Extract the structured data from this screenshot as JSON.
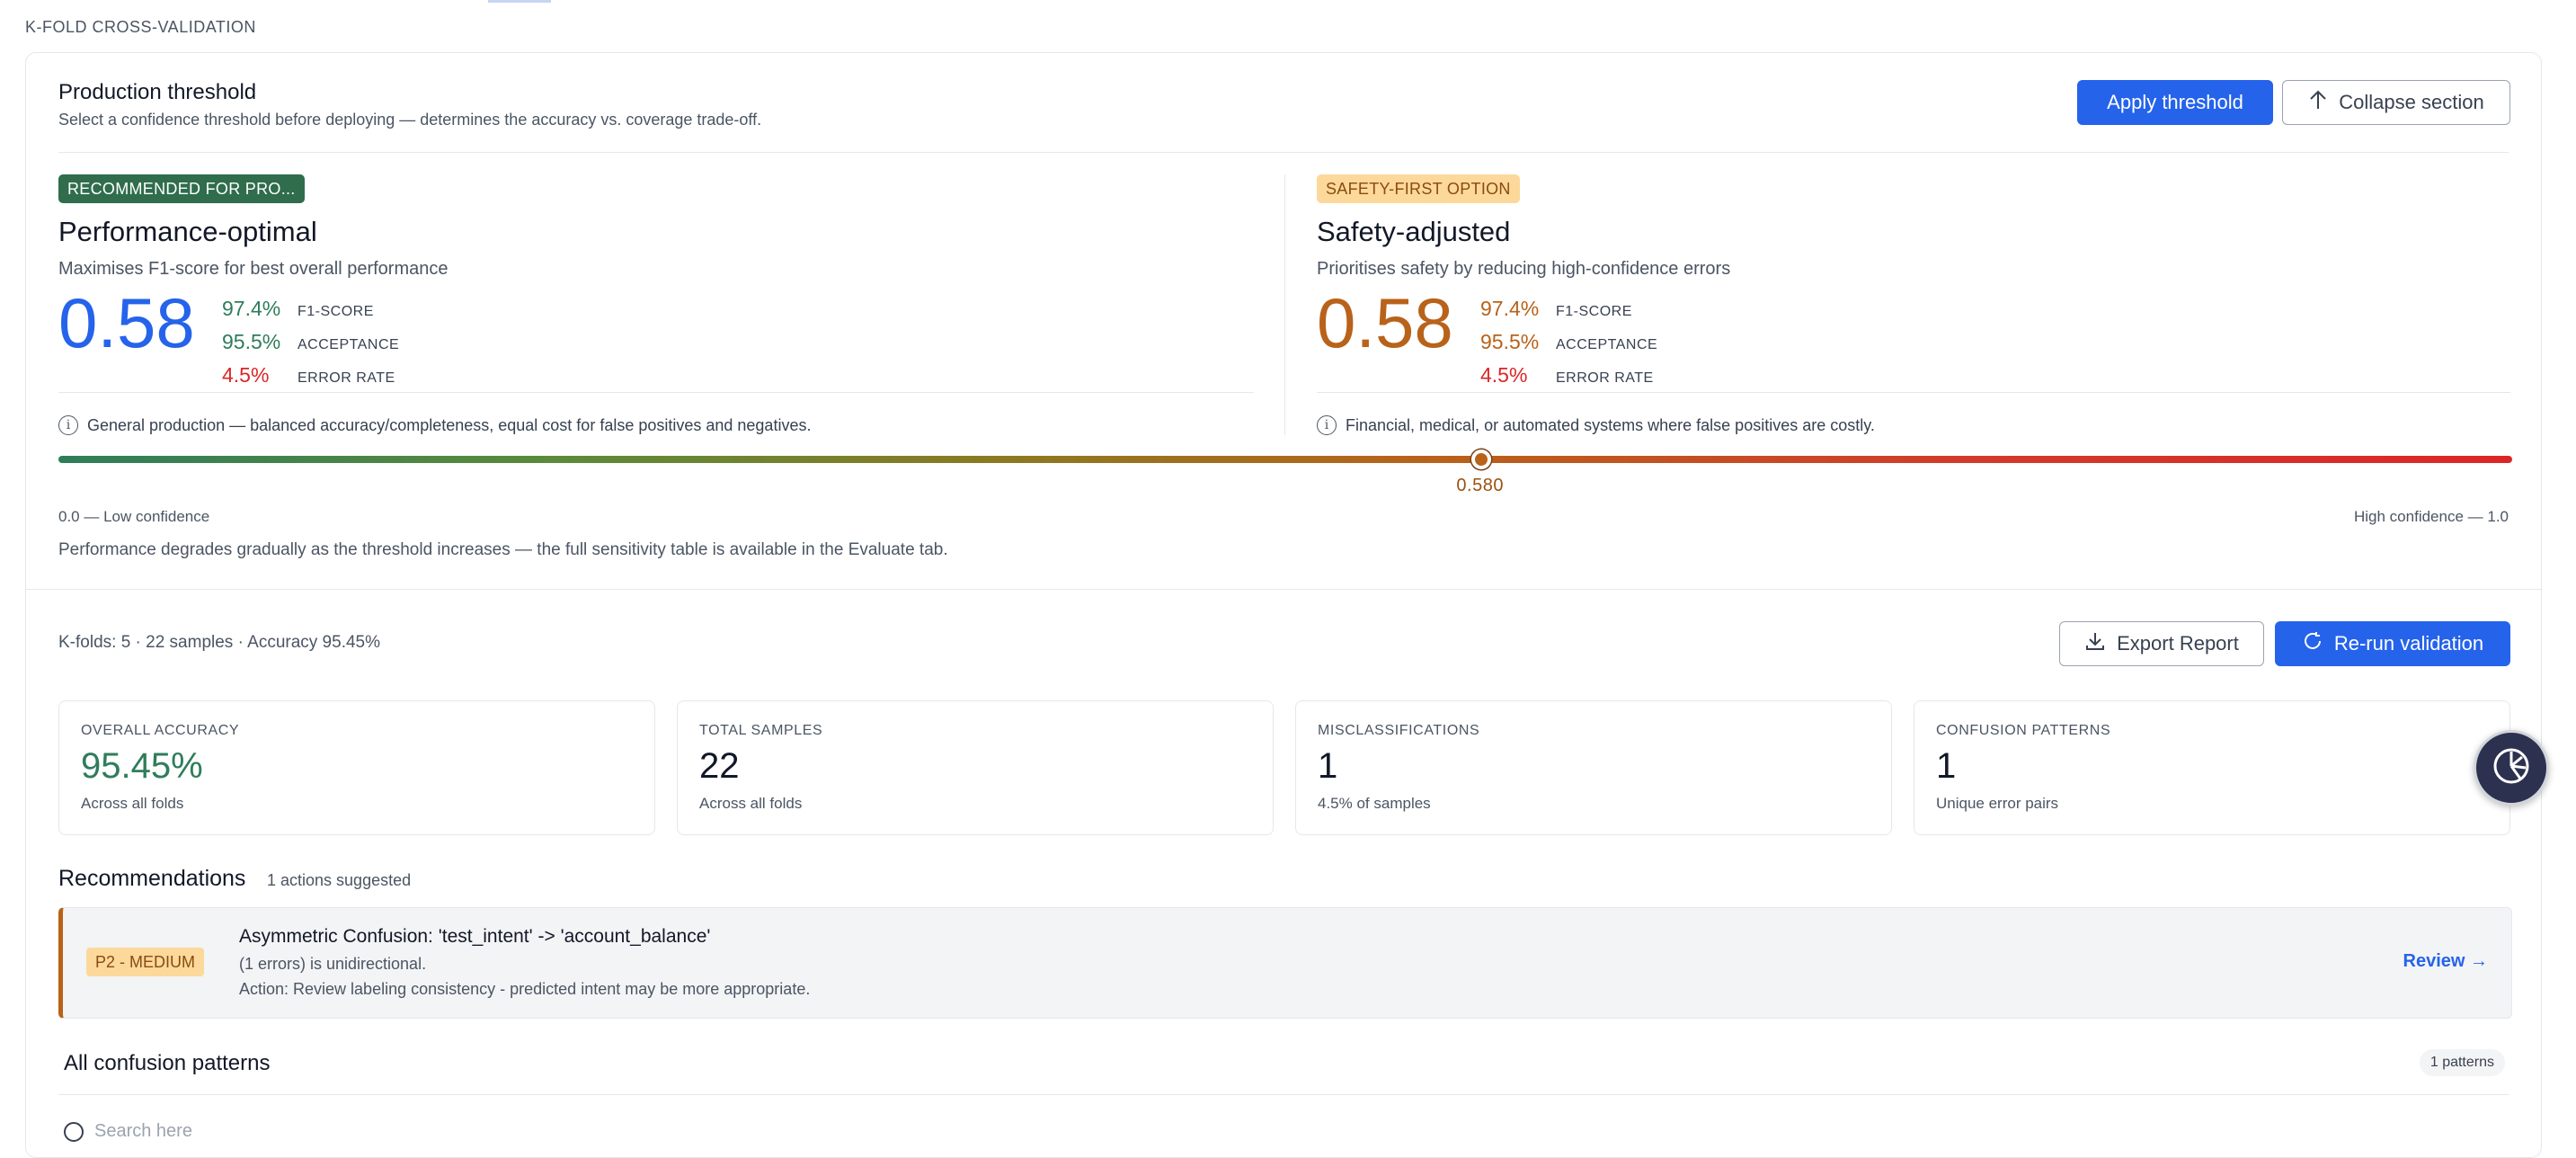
{
  "section_label": "K-FOLD CROSS-VALIDATION",
  "threshold": {
    "title": "Production threshold",
    "subtitle": "Select a confidence threshold before deploying — determines the accuracy vs. coverage trade-off.",
    "apply_label": "Apply threshold",
    "collapse_label": "Collapse section"
  },
  "options": [
    {
      "badge": "RECOMMENDED FOR PRO...",
      "title": "Performance-optimal",
      "subtitle": "Maximises F1-score for best overall performance",
      "value": "0.58",
      "metrics": [
        {
          "value": "97.4%",
          "label": "F1-SCORE"
        },
        {
          "value": "95.5%",
          "label": "ACCEPTANCE"
        },
        {
          "value": "4.5%",
          "label": "ERROR RATE"
        }
      ],
      "info": "General production — balanced accuracy/completeness, equal cost for false positives and negatives."
    },
    {
      "badge": "SAFETY-FIRST OPTION",
      "title": "Safety-adjusted",
      "subtitle": "Prioritises safety by reducing high-confidence errors",
      "value": "0.58",
      "metrics": [
        {
          "value": "97.4%",
          "label": "F1-SCORE"
        },
        {
          "value": "95.5%",
          "label": "ACCEPTANCE"
        },
        {
          "value": "4.5%",
          "label": "ERROR RATE"
        }
      ],
      "info": "Financial, medical, or automated systems where false positives are costly."
    }
  ],
  "slider": {
    "value": 0.58,
    "value_label": "0.580",
    "min_label": "0.0 — Low confidence",
    "max_label": "High confidence — 1.0",
    "note": "Performance degrades gradually as the threshold increases — the full sensitivity table is available in the Evaluate tab."
  },
  "kfold": {
    "meta": "K-folds: 5 · 22 samples · Accuracy 95.45%",
    "export_label": "Export Report",
    "rerun_label": "Re-run validation",
    "stats": [
      {
        "label": "OVERALL ACCURACY",
        "value": "95.45%",
        "sub": "Across all folds"
      },
      {
        "label": "TOTAL SAMPLES",
        "value": "22",
        "sub": "Across all folds"
      },
      {
        "label": "MISCLASSIFICATIONS",
        "value": "1",
        "sub": "4.5% of samples"
      },
      {
        "label": "CONFUSION PATTERNS",
        "value": "1",
        "sub": "Unique error pairs"
      }
    ]
  },
  "recommendations": {
    "title": "Recommendations",
    "count": "1 actions suggested",
    "items": [
      {
        "priority": "P2 - MEDIUM",
        "title": "Asymmetric Confusion: 'test_intent' -> 'account_balance'",
        "line1": "(1 errors) is unidirectional.",
        "line2": "Action: Review labeling consistency - predicted intent may be more appropriate.",
        "link": "Review →"
      }
    ]
  },
  "patterns": {
    "title": "All confusion patterns",
    "count": "1 patterns",
    "search_placeholder": "Search here"
  },
  "colors": {
    "primary": "#2563eb",
    "green": "#2f7d5a",
    "amber": "#b8621a",
    "red": "#dc2626"
  }
}
